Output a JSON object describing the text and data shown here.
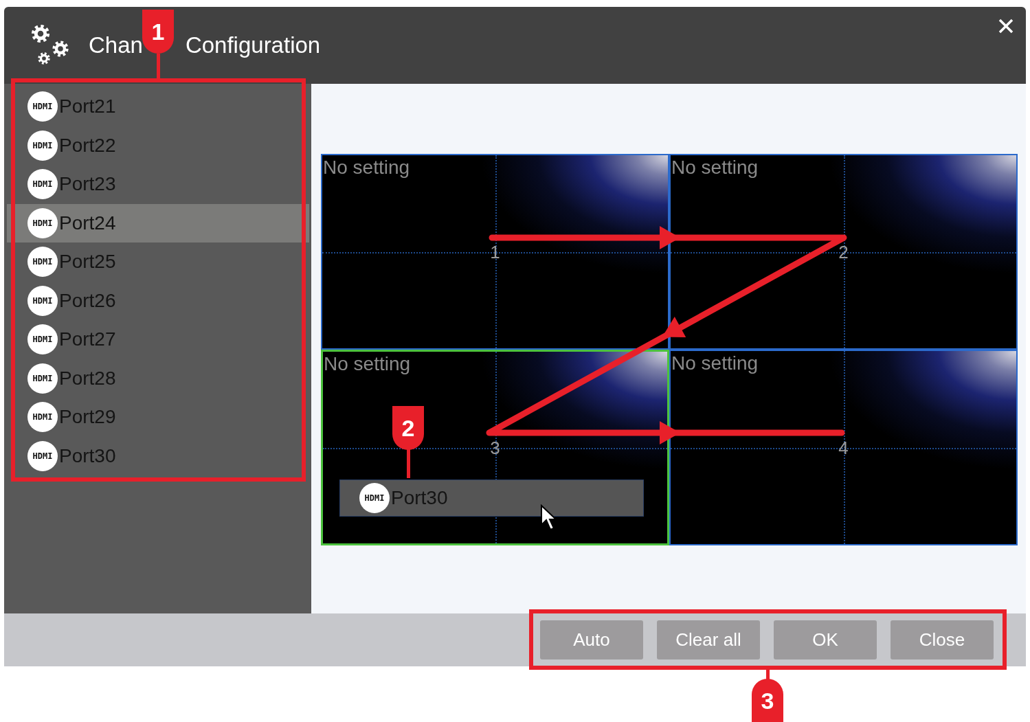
{
  "window": {
    "title_parts": [
      "Chan",
      "Configuration"
    ]
  },
  "port_list": [
    {
      "badge": "HDMI",
      "label": "Port21",
      "selected": false
    },
    {
      "badge": "HDMI",
      "label": "Port22",
      "selected": false
    },
    {
      "badge": "HDMI",
      "label": "Port23",
      "selected": false
    },
    {
      "badge": "HDMI",
      "label": "Port24",
      "selected": true
    },
    {
      "badge": "HDMI",
      "label": "Port25",
      "selected": false
    },
    {
      "badge": "HDMI",
      "label": "Port26",
      "selected": false
    },
    {
      "badge": "HDMI",
      "label": "Port27",
      "selected": false
    },
    {
      "badge": "HDMI",
      "label": "Port28",
      "selected": false
    },
    {
      "badge": "HDMI",
      "label": "Port29",
      "selected": false
    },
    {
      "badge": "HDMI",
      "label": "Port30",
      "selected": false
    }
  ],
  "screen_grid": [
    {
      "label": "No setting",
      "number": "1",
      "selected": false
    },
    {
      "label": "No setting",
      "number": "2",
      "selected": false
    },
    {
      "label": "No setting",
      "number": "3",
      "selected": true
    },
    {
      "label": "No setting",
      "number": "4",
      "selected": false
    }
  ],
  "dragged_item": {
    "badge": "HDMI",
    "label": "Port30"
  },
  "buttons": [
    "Auto",
    "Clear all",
    "OK",
    "Close"
  ],
  "callouts": [
    {
      "label": "1"
    },
    {
      "label": "2"
    },
    {
      "label": "3"
    }
  ]
}
